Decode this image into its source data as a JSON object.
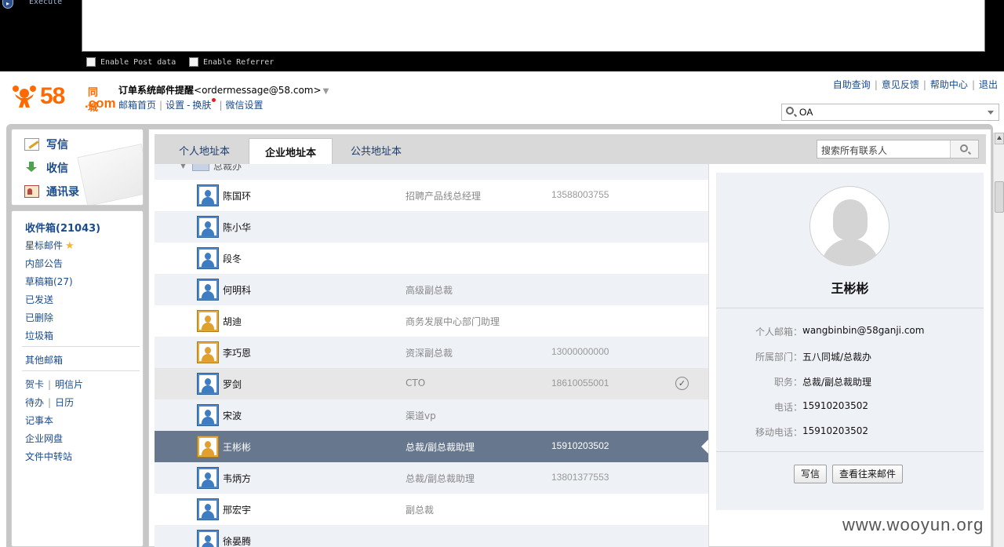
{
  "toolbar": {
    "execute_label": "Execute",
    "post_data_label": "Enable Post data",
    "referrer_label": "Enable Referrer"
  },
  "logo": {
    "brand": "58",
    "brand_cn": "同城",
    "brand_com": ".com"
  },
  "account": {
    "sender_name": "订单系统邮件提醒",
    "sender_email": "<ordermessage@58.com>",
    "links": [
      "邮箱首页",
      "设置",
      "换肤",
      "微信设置"
    ],
    "link_joiner": "-"
  },
  "top_links": [
    "自助查询",
    "意见反馈",
    "帮助中心",
    "退出"
  ],
  "search": {
    "value": "OA"
  },
  "quick_actions": [
    {
      "label": "写信",
      "icon": "compose-icon"
    },
    {
      "label": "收信",
      "icon": "inbox-download-icon"
    },
    {
      "label": "通讯录",
      "icon": "contacts-icon"
    }
  ],
  "folders": {
    "inbox": "收件箱(21043)",
    "starred": "星标邮件",
    "notice": "内部公告",
    "drafts": "草稿箱(27)",
    "sent": "已发送",
    "deleted": "已删除",
    "spam": "垃圾箱",
    "other": "其他邮箱",
    "card": "贺卡",
    "postcard": "明信片",
    "todo": "待办",
    "calendar": "日历",
    "notes": "记事本",
    "disk": "企业网盘",
    "transfer": "文件中转站"
  },
  "tabs": [
    "个人地址本",
    "企业地址本",
    "公共地址本"
  ],
  "active_tab": "企业地址本",
  "contact_search": {
    "placeholder": "搜索所有联系人"
  },
  "group": {
    "name": "总裁办"
  },
  "contacts": [
    {
      "name": "陈国环",
      "title": "招聘产品线总经理",
      "phone": "13588003755",
      "gender": "m"
    },
    {
      "name": "陈小华",
      "title": "",
      "phone": "",
      "gender": "m"
    },
    {
      "name": "段冬",
      "title": "",
      "phone": "",
      "gender": "m"
    },
    {
      "name": "何明科",
      "title": "高级副总裁",
      "phone": "",
      "gender": "m"
    },
    {
      "name": "胡迪",
      "title": "商务发展中心部门助理",
      "phone": "",
      "gender": "f"
    },
    {
      "name": "李巧恩",
      "title": "资深副总裁",
      "phone": "13000000000",
      "gender": "f"
    },
    {
      "name": "罗剑",
      "title": "CTO",
      "phone": "18610055001",
      "gender": "m",
      "checked": true
    },
    {
      "name": "宋波",
      "title": "渠道vp",
      "phone": "",
      "gender": "m"
    },
    {
      "name": "王彬彬",
      "title": "总裁/副总裁助理",
      "phone": "15910203502",
      "gender": "f",
      "selected": true
    },
    {
      "name": "韦炳方",
      "title": "总裁/副总裁助理",
      "phone": "13801377553",
      "gender": "m"
    },
    {
      "name": "邢宏宇",
      "title": "副总裁",
      "phone": "",
      "gender": "m"
    },
    {
      "name": "徐晏腾",
      "title": "",
      "phone": "",
      "gender": "m"
    }
  ],
  "detail": {
    "name": "王彬彬",
    "email_label": "个人邮箱：",
    "email": "wangbinbin@58ganji.com",
    "dept_label": "所属部门：",
    "dept": "五八同城/总裁办",
    "position_label": "职务：",
    "position": "总裁/副总裁助理",
    "phone_label": "电话：",
    "phone": "15910203502",
    "mobile_label": "移动电话：",
    "mobile": "15910203502",
    "write_button": "写信",
    "history_button": "查看往来邮件"
  },
  "watermark": "www.wooyun.org",
  "colors": {
    "brand": "#ff6a00",
    "link": "#1a4b8c",
    "selected_row": "#67778d"
  }
}
